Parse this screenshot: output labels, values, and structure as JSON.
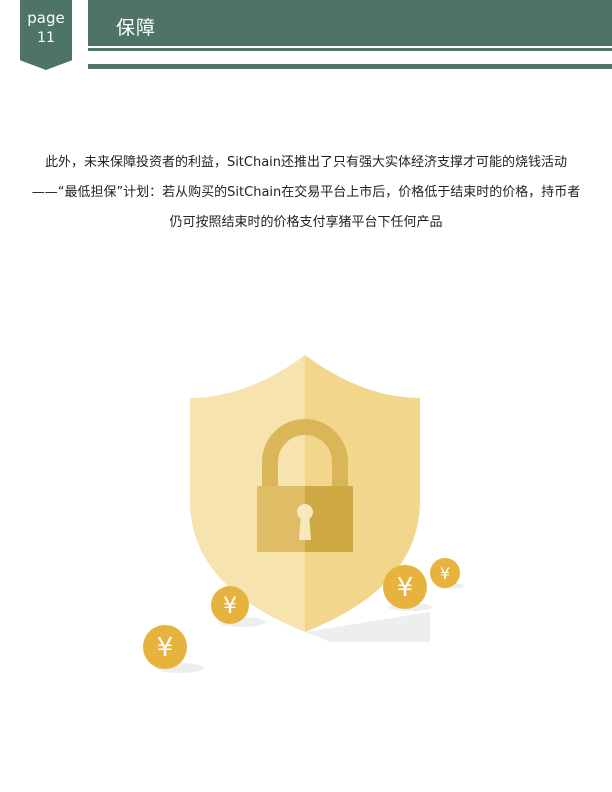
{
  "header": {
    "page_label": "page",
    "page_number": "11",
    "title": "保障"
  },
  "content": {
    "paragraph": "此外，未来保障投资者的利益，SitChain还推出了只有强大实体经济支撑才可能的烧钱活动——“最低担保”计划：若从购买的SitChain在交易平台上市后，价格低于结束时的价格，持币者仍可按照结束时的价格支付享猪平台下任何产品"
  },
  "illustration": {
    "coin_symbol": "¥",
    "colors": {
      "shield_left": "#f6e3ad",
      "shield_right": "#f2d68c",
      "lock": "#d8b557",
      "coin": "#e8b23e"
    }
  }
}
